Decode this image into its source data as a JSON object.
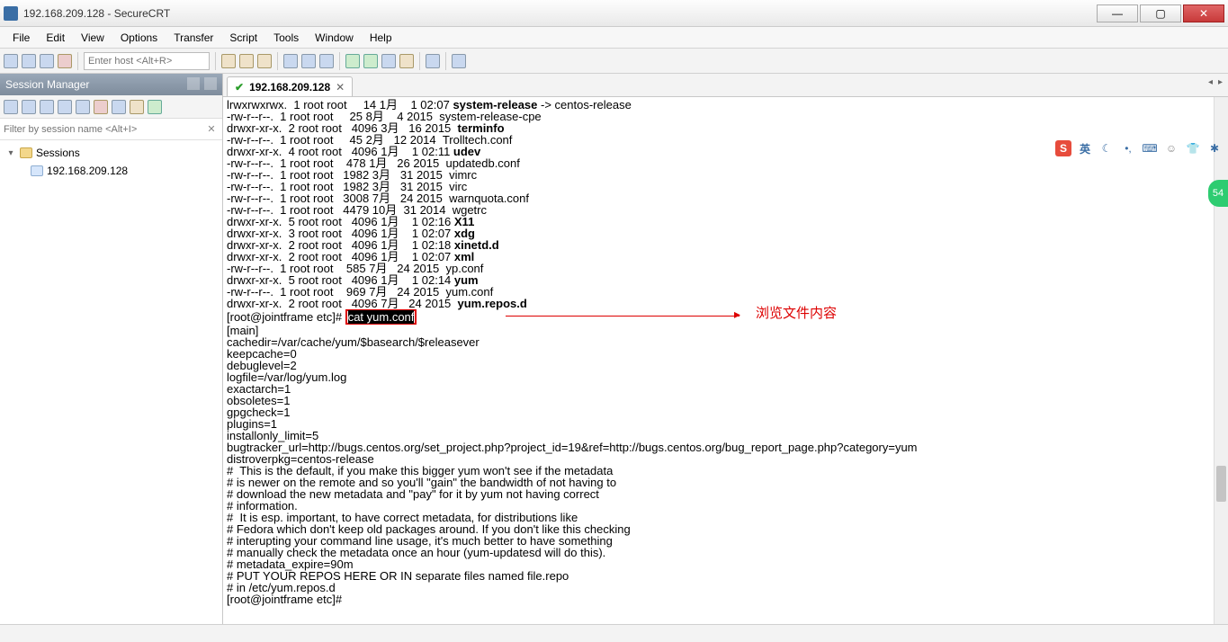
{
  "window": {
    "title": "192.168.209.128 - SecureCRT"
  },
  "menus": [
    "File",
    "Edit",
    "View",
    "Options",
    "Transfer",
    "Script",
    "Tools",
    "Window",
    "Help"
  ],
  "host_placeholder": "Enter host <Alt+R>",
  "session_manager": {
    "title": "Session Manager",
    "filter_placeholder": "Filter by session name <Alt+I>",
    "root": "Sessions",
    "items": [
      "192.168.209.128"
    ]
  },
  "tab": {
    "label": "192.168.209.128",
    "connected": true
  },
  "terminal": {
    "ls": [
      {
        "perm": "lrwxrwxrwx.",
        "n": "1",
        "o": "root",
        "g": "root",
        "size": "14",
        "mon": "1月",
        "day": "1",
        "time": "02:07",
        "name": "system-release",
        "link": " -> centos-release",
        "bold": true
      },
      {
        "perm": "-rw-r--r--.",
        "n": "1",
        "o": "root",
        "g": "root",
        "size": "25",
        "mon": "8月",
        "day": "4",
        "time": "2015",
        "name": "system-release-cpe"
      },
      {
        "perm": "drwxr-xr-x.",
        "n": "2",
        "o": "root",
        "g": "root",
        "size": "4096",
        "mon": "3月",
        "day": "16",
        "time": "2015",
        "name": "terminfo",
        "bold": true
      },
      {
        "perm": "-rw-r--r--.",
        "n": "1",
        "o": "root",
        "g": "root",
        "size": "45",
        "mon": "2月",
        "day": "12",
        "time": "2014",
        "name": "Trolltech.conf"
      },
      {
        "perm": "drwxr-xr-x.",
        "n": "4",
        "o": "root",
        "g": "root",
        "size": "4096",
        "mon": "1月",
        "day": "1",
        "time": "02:11",
        "name": "udev",
        "bold": true
      },
      {
        "perm": "-rw-r--r--.",
        "n": "1",
        "o": "root",
        "g": "root",
        "size": "478",
        "mon": "1月",
        "day": "26",
        "time": "2015",
        "name": "updatedb.conf"
      },
      {
        "perm": "-rw-r--r--.",
        "n": "1",
        "o": "root",
        "g": "root",
        "size": "1982",
        "mon": "3月",
        "day": "31",
        "time": "2015",
        "name": "vimrc"
      },
      {
        "perm": "-rw-r--r--.",
        "n": "1",
        "o": "root",
        "g": "root",
        "size": "1982",
        "mon": "3月",
        "day": "31",
        "time": "2015",
        "name": "virc"
      },
      {
        "perm": "-rw-r--r--.",
        "n": "1",
        "o": "root",
        "g": "root",
        "size": "3008",
        "mon": "7月",
        "day": "24",
        "time": "2015",
        "name": "warnquota.conf"
      },
      {
        "perm": "-rw-r--r--.",
        "n": "1",
        "o": "root",
        "g": "root",
        "size": "4479",
        "mon": "10月",
        "day": "31",
        "time": "2014",
        "name": "wgetrc"
      },
      {
        "perm": "drwxr-xr-x.",
        "n": "5",
        "o": "root",
        "g": "root",
        "size": "4096",
        "mon": "1月",
        "day": "1",
        "time": "02:16",
        "name": "X11",
        "bold": true
      },
      {
        "perm": "drwxr-xr-x.",
        "n": "3",
        "o": "root",
        "g": "root",
        "size": "4096",
        "mon": "1月",
        "day": "1",
        "time": "02:07",
        "name": "xdg",
        "bold": true
      },
      {
        "perm": "drwxr-xr-x.",
        "n": "2",
        "o": "root",
        "g": "root",
        "size": "4096",
        "mon": "1月",
        "day": "1",
        "time": "02:18",
        "name": "xinetd.d",
        "bold": true
      },
      {
        "perm": "drwxr-xr-x.",
        "n": "2",
        "o": "root",
        "g": "root",
        "size": "4096",
        "mon": "1月",
        "day": "1",
        "time": "02:07",
        "name": "xml",
        "bold": true
      },
      {
        "perm": "-rw-r--r--.",
        "n": "1",
        "o": "root",
        "g": "root",
        "size": "585",
        "mon": "7月",
        "day": "24",
        "time": "2015",
        "name": "yp.conf"
      },
      {
        "perm": "drwxr-xr-x.",
        "n": "5",
        "o": "root",
        "g": "root",
        "size": "4096",
        "mon": "1月",
        "day": "1",
        "time": "02:14",
        "name": "yum",
        "bold": true
      },
      {
        "perm": "-rw-r--r--.",
        "n": "1",
        "o": "root",
        "g": "root",
        "size": "969",
        "mon": "7月",
        "day": "24",
        "time": "2015",
        "name": "yum.conf"
      },
      {
        "perm": "drwxr-xr-x.",
        "n": "2",
        "o": "root",
        "g": "root",
        "size": "4096",
        "mon": "7月",
        "day": "24",
        "time": "2015",
        "name": "yum.repos.d",
        "bold": true
      }
    ],
    "prompt1_pre": "[root@jointframe etc]# ",
    "command_highlight": "cat yum.conf",
    "annotation": "浏览文件内容",
    "cat_lines": [
      "[main]",
      "cachedir=/var/cache/yum/$basearch/$releasever",
      "keepcache=0",
      "debuglevel=2",
      "logfile=/var/log/yum.log",
      "exactarch=1",
      "obsoletes=1",
      "gpgcheck=1",
      "plugins=1",
      "installonly_limit=5",
      "bugtracker_url=http://bugs.centos.org/set_project.php?project_id=19&ref=http://bugs.centos.org/bug_report_page.php?category=yum",
      "distroverpkg=centos-release",
      "",
      "#  This is the default, if you make this bigger yum won't see if the metadata",
      "# is newer on the remote and so you'll \"gain\" the bandwidth of not having to",
      "# download the new metadata and \"pay\" for it by yum not having correct",
      "# information.",
      "#  It is esp. important, to have correct metadata, for distributions like",
      "# Fedora which don't keep old packages around. If you don't like this checking",
      "# interupting your command line usage, it's much better to have something",
      "# manually check the metadata once an hour (yum-updatesd will do this).",
      "# metadata_expire=90m",
      "",
      "# PUT YOUR REPOS HERE OR IN separate files named file.repo",
      "# in /etc/yum.repos.d",
      "[root@jointframe etc]# "
    ]
  },
  "ime_label": "英"
}
